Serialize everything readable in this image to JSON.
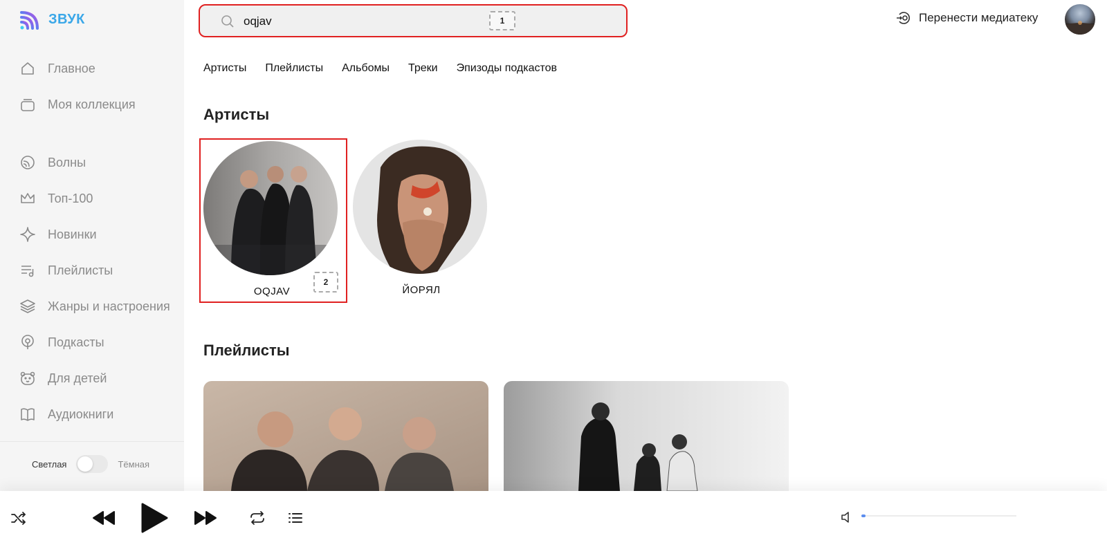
{
  "app": {
    "name": "ЗВУК",
    "accent": "#3aa7e8",
    "highlight": "#e02020"
  },
  "sidebar": {
    "items": [
      {
        "label": "Главное",
        "icon": "home-icon"
      },
      {
        "label": "Моя коллекция",
        "icon": "collection-icon"
      },
      {
        "label": "Волны",
        "icon": "waves-icon"
      },
      {
        "label": "Топ-100",
        "icon": "crown-icon"
      },
      {
        "label": "Новинки",
        "icon": "sparkle-icon"
      },
      {
        "label": "Плейлисты",
        "icon": "playlist-icon"
      },
      {
        "label": "Жанры и настроения",
        "icon": "layers-icon"
      },
      {
        "label": "Подкасты",
        "icon": "podcast-icon"
      },
      {
        "label": "Для детей",
        "icon": "bear-icon"
      },
      {
        "label": "Аудиокниги",
        "icon": "book-icon"
      }
    ],
    "theme": {
      "light_label": "Светлая",
      "dark_label": "Тёмная"
    }
  },
  "search": {
    "value": "oqjav",
    "marker": "1"
  },
  "header": {
    "transfer_label": "Перенести медиатеку"
  },
  "tabs": [
    "Артисты",
    "Плейлисты",
    "Альбомы",
    "Треки",
    "Эпизоды подкастов"
  ],
  "sections": {
    "artists_title": "Артисты",
    "playlists_title": "Плейлисты"
  },
  "artists": [
    {
      "name": "OQJAV",
      "marker": "2"
    },
    {
      "name": "ЙОРЯЛ"
    }
  ],
  "player": {
    "icons": [
      "shuffle-icon",
      "previous-icon",
      "play-icon",
      "next-icon",
      "repeat-icon",
      "queue-icon",
      "volume-icon"
    ],
    "volume": 0.02
  }
}
